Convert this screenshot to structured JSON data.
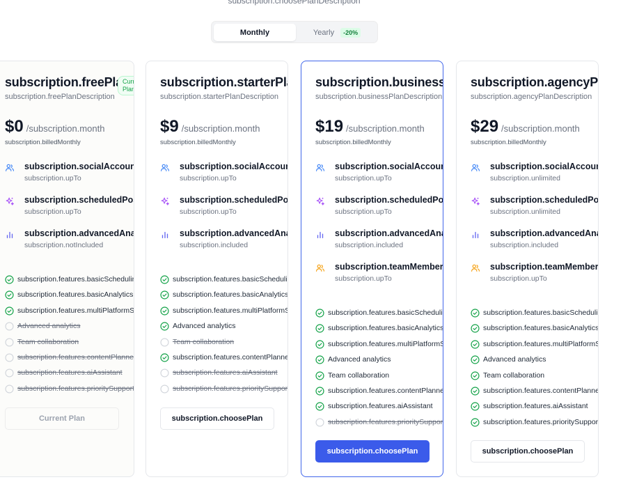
{
  "header": {
    "description": "subscription.choosePlanDescription"
  },
  "billing_toggle": {
    "monthly_label": "Monthly",
    "yearly_label": "Yearly",
    "yearly_discount": "-20%",
    "selected": "Monthly"
  },
  "colors": {
    "primary": "#3b5bea",
    "check_green": "#16a34a",
    "users_icon": "#3b82f6",
    "sparkle_icon": "#a855f7",
    "chart_icon": "#6366f1",
    "team_icon": "#f59e0b"
  },
  "plans": [
    {
      "name": "subscription.freePlan",
      "description": "subscription.freePlanDescription",
      "badge": "Current Plan",
      "price": "$0",
      "period": "/subscription.month",
      "billed": "subscription.billedMonthly",
      "features": [
        {
          "icon": "users-icon",
          "title": "subscription.socialAccounts",
          "sub": "subscription.upTo"
        },
        {
          "icon": "sparkle-icon",
          "title": "subscription.scheduledPosts",
          "sub": "subscription.upTo"
        },
        {
          "icon": "chart-icon",
          "title": "subscription.advancedAnalytics",
          "sub": "subscription.notIncluded"
        }
      ],
      "checklist": [
        {
          "text": "subscription.features.basicScheduling",
          "included": true
        },
        {
          "text": "subscription.features.basicAnalytics",
          "included": true
        },
        {
          "text": "subscription.features.multiPlatformSupport",
          "included": true
        },
        {
          "text": "Advanced analytics",
          "included": false
        },
        {
          "text": "Team collaboration",
          "included": false
        },
        {
          "text": "subscription.features.contentPlanner",
          "included": false
        },
        {
          "text": "subscription.features.aiAssistant",
          "included": false
        },
        {
          "text": "subscription.features.prioritySupport",
          "included": false
        }
      ],
      "button": "Current Plan"
    },
    {
      "name": "subscription.starterPlan",
      "description": "subscription.starterPlanDescription",
      "price": "$9",
      "period": "/subscription.month",
      "billed": "subscription.billedMonthly",
      "features": [
        {
          "icon": "users-icon",
          "title": "subscription.socialAccounts",
          "sub": "subscription.upTo"
        },
        {
          "icon": "sparkle-icon",
          "title": "subscription.scheduledPosts",
          "sub": "subscription.upTo"
        },
        {
          "icon": "chart-icon",
          "title": "subscription.advancedAnalytics",
          "sub": "subscription.included"
        }
      ],
      "checklist": [
        {
          "text": "subscription.features.basicScheduling",
          "included": true
        },
        {
          "text": "subscription.features.basicAnalytics",
          "included": true
        },
        {
          "text": "subscription.features.multiPlatformSupport",
          "included": true
        },
        {
          "text": "Advanced analytics",
          "included": true
        },
        {
          "text": "Team collaboration",
          "included": false
        },
        {
          "text": "subscription.features.contentPlanner",
          "included": true
        },
        {
          "text": "subscription.features.aiAssistant",
          "included": false
        },
        {
          "text": "subscription.features.prioritySupport",
          "included": false
        }
      ],
      "button": "subscription.choosePlan"
    },
    {
      "name": "subscription.businessPlan",
      "description": "subscription.businessPlanDescription",
      "price": "$19",
      "period": "/subscription.month",
      "billed": "subscription.billedMonthly",
      "features": [
        {
          "icon": "users-icon",
          "title": "subscription.socialAccounts",
          "sub": "subscription.upTo"
        },
        {
          "icon": "sparkle-icon",
          "title": "subscription.scheduledPosts",
          "sub": "subscription.upTo"
        },
        {
          "icon": "chart-icon",
          "title": "subscription.advancedAnalytics",
          "sub": "subscription.included"
        },
        {
          "icon": "team-icon",
          "title": "subscription.teamMembers",
          "sub": "subscription.upTo"
        }
      ],
      "checklist": [
        {
          "text": "subscription.features.basicScheduling",
          "included": true
        },
        {
          "text": "subscription.features.basicAnalytics",
          "included": true
        },
        {
          "text": "subscription.features.multiPlatformSupport",
          "included": true
        },
        {
          "text": "Advanced analytics",
          "included": true
        },
        {
          "text": "Team collaboration",
          "included": true
        },
        {
          "text": "subscription.features.contentPlanner",
          "included": true
        },
        {
          "text": "subscription.features.aiAssistant",
          "included": true
        },
        {
          "text": "subscription.features.prioritySupport",
          "included": false
        }
      ],
      "button": "subscription.choosePlan"
    },
    {
      "name": "subscription.agencyPlan",
      "description": "subscription.agencyPlanDescription",
      "price": "$29",
      "period": "/subscription.month",
      "billed": "subscription.billedMonthly",
      "features": [
        {
          "icon": "users-icon",
          "title": "subscription.socialAccounts",
          "sub": "subscription.unlimited"
        },
        {
          "icon": "sparkle-icon",
          "title": "subscription.scheduledPosts",
          "sub": "subscription.unlimited"
        },
        {
          "icon": "chart-icon",
          "title": "subscription.advancedAnalytics",
          "sub": "subscription.included"
        },
        {
          "icon": "team-icon",
          "title": "subscription.teamMembers",
          "sub": "subscription.upTo"
        }
      ],
      "checklist": [
        {
          "text": "subscription.features.basicScheduling",
          "included": true
        },
        {
          "text": "subscription.features.basicAnalytics",
          "included": true
        },
        {
          "text": "subscription.features.multiPlatformSupport",
          "included": true
        },
        {
          "text": "Advanced analytics",
          "included": true
        },
        {
          "text": "Team collaboration",
          "included": true
        },
        {
          "text": "subscription.features.contentPlanner",
          "included": true
        },
        {
          "text": "subscription.features.aiAssistant",
          "included": true
        },
        {
          "text": "subscription.features.prioritySupport",
          "included": true
        }
      ],
      "button": "subscription.choosePlan"
    }
  ]
}
